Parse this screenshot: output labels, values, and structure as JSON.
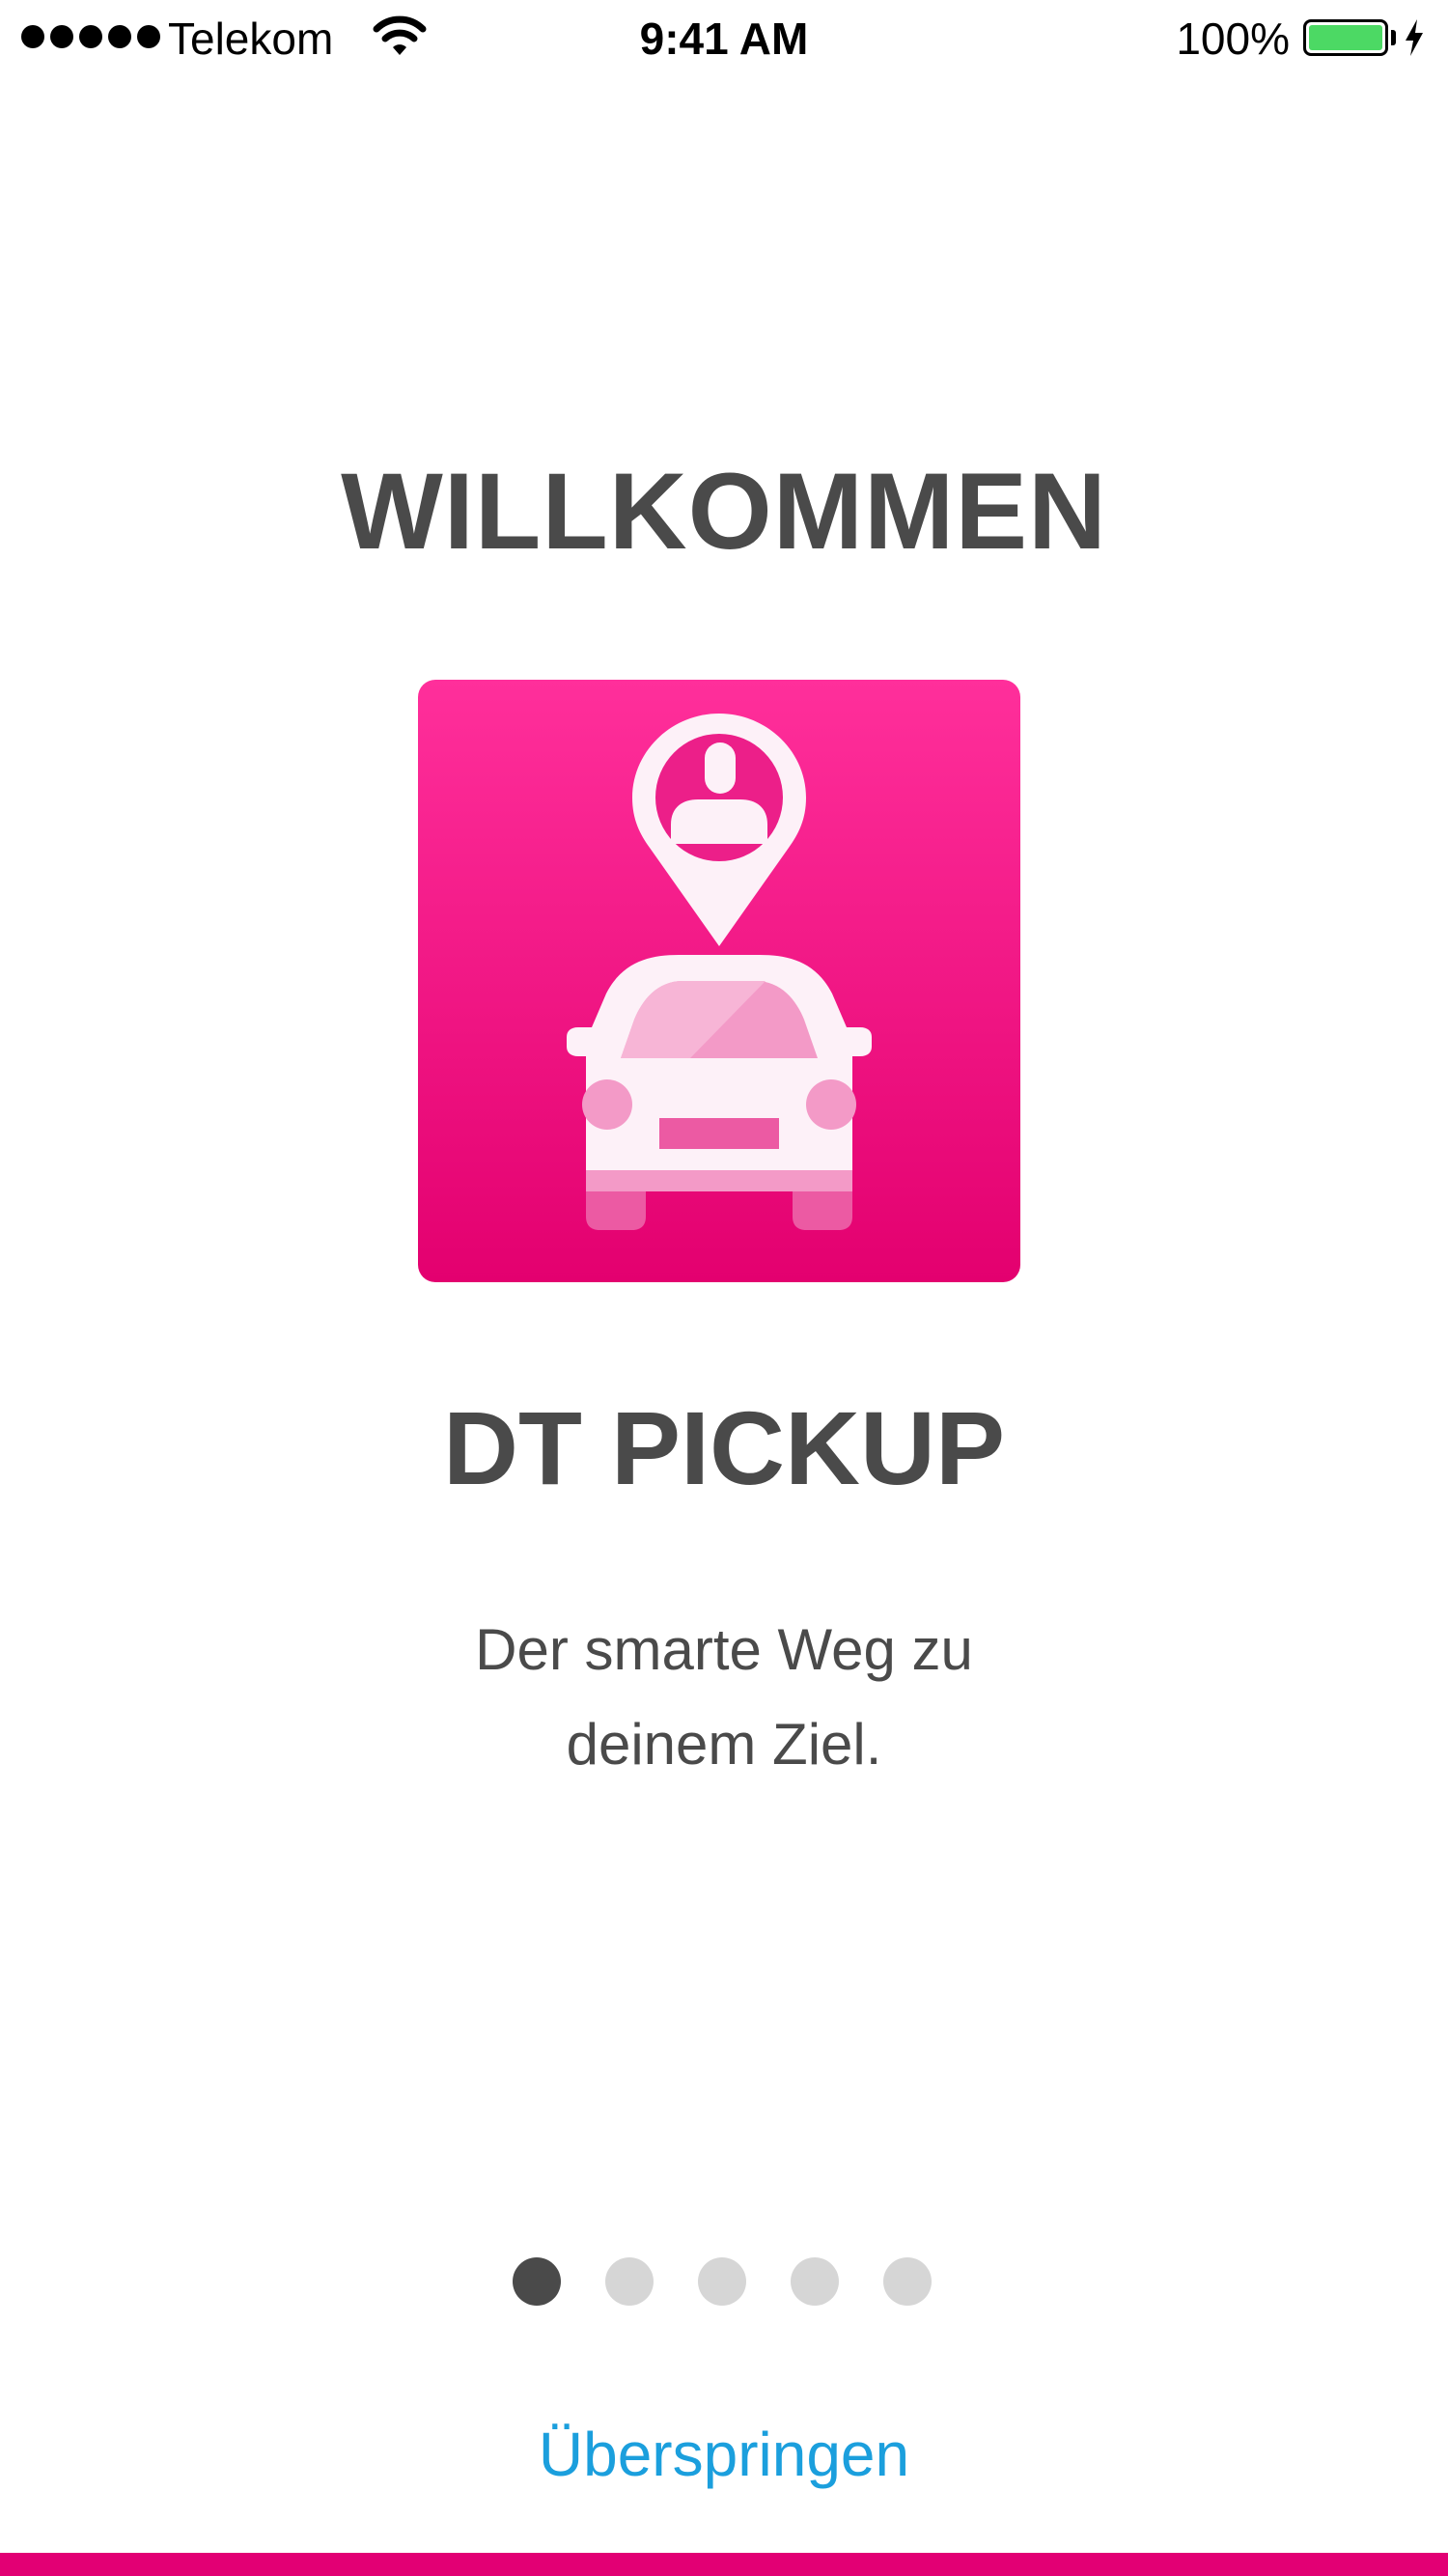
{
  "status_bar": {
    "carrier": "Telekom",
    "time": "9:41 AM",
    "battery_percent": "100%",
    "signal_bars": 5,
    "battery_color": "#4cd964"
  },
  "onboarding": {
    "title": "WILLKOMMEN",
    "app_name": "DT PICKUP",
    "tagline_line1": "Der smarte Weg zu",
    "tagline_line2": "deinem Ziel.",
    "app_icon": "car-pickup-location-icon",
    "brand_color": "#e20074"
  },
  "pager": {
    "total_pages": 5,
    "current_page": 1
  },
  "actions": {
    "skip_label": "Überspringen",
    "skip_color": "#1b9fdd"
  }
}
